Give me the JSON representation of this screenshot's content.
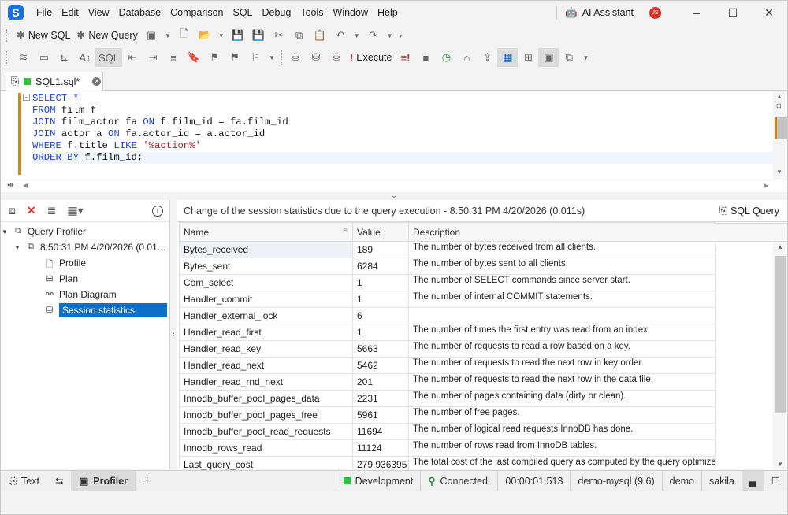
{
  "menu": [
    "File",
    "Edit",
    "View",
    "Database",
    "Comparison",
    "SQL",
    "Debug",
    "Tools",
    "Window",
    "Help"
  ],
  "ai_assistant": {
    "label": "AI Assistant",
    "avatar_initials": "JS"
  },
  "window_controls": {
    "minimize": "–",
    "maximize": "☐",
    "close": "✕"
  },
  "toolbar1": {
    "new_sql": "New SQL",
    "new_query": "New Query"
  },
  "toolbar2": {
    "execute": "Execute"
  },
  "doc_tab": {
    "label": "SQL1.sql*"
  },
  "editor": {
    "lines": [
      [
        {
          "t": "SELECT *",
          "c": "kw"
        }
      ],
      [
        {
          "t": "FROM ",
          "c": "kw"
        },
        {
          "t": "film f",
          "c": "id"
        }
      ],
      [
        {
          "t": "JOIN ",
          "c": "kw"
        },
        {
          "t": "film_actor fa ",
          "c": "id"
        },
        {
          "t": "ON ",
          "c": "kw"
        },
        {
          "t": "f.film_id = fa.film_id",
          "c": "id"
        }
      ],
      [
        {
          "t": "JOIN ",
          "c": "kw"
        },
        {
          "t": "actor a ",
          "c": "id"
        },
        {
          "t": "ON ",
          "c": "kw"
        },
        {
          "t": "fa.actor_id = a.actor_id",
          "c": "id"
        }
      ],
      [
        {
          "t": "WHERE ",
          "c": "kw"
        },
        {
          "t": "f.title ",
          "c": "id"
        },
        {
          "t": "LIKE ",
          "c": "kw"
        },
        {
          "t": "'%action%'",
          "c": "str"
        }
      ],
      [
        {
          "t": "ORDER BY ",
          "c": "kw"
        },
        {
          "t": "f.film_id;",
          "c": "id"
        }
      ]
    ]
  },
  "profiler_tree": {
    "root": "Query Profiler",
    "session": "8:50:31 PM 4/20/2026 (0.01...",
    "children": [
      "Profile",
      "Plan",
      "Plan Diagram",
      "Session statistics"
    ]
  },
  "stats_panel": {
    "header": "Change of the session statistics due to the query execution - 8:50:31 PM 4/20/2026 (0.011s)",
    "sql_query_button": "SQL Query",
    "columns": [
      "Name",
      "Value",
      "Description"
    ],
    "rows": [
      {
        "name": "Bytes_received",
        "value": "189",
        "desc": "The number of bytes received from all clients."
      },
      {
        "name": "Bytes_sent",
        "value": "6284",
        "desc": "The number of bytes sent to all clients."
      },
      {
        "name": "Com_select",
        "value": "1",
        "desc": "The number of SELECT commands since server start."
      },
      {
        "name": "Handler_commit",
        "value": "1",
        "desc": "The number of internal COMMIT statements."
      },
      {
        "name": "Handler_external_lock",
        "value": "6",
        "desc": ""
      },
      {
        "name": "Handler_read_first",
        "value": "1",
        "desc": "The number of times the first entry was read from an index."
      },
      {
        "name": "Handler_read_key",
        "value": "5663",
        "desc": "The number of requests to read a row based on a key."
      },
      {
        "name": "Handler_read_next",
        "value": "5462",
        "desc": "The number of requests to read the next row in key order."
      },
      {
        "name": "Handler_read_rnd_next",
        "value": "201",
        "desc": "The number of requests to read the next row in the data file."
      },
      {
        "name": "Innodb_buffer_pool_pages_data",
        "value": "2231",
        "desc": "The number of pages containing data (dirty or clean)."
      },
      {
        "name": "Innodb_buffer_pool_pages_free",
        "value": "5961",
        "desc": "The number of free pages."
      },
      {
        "name": "Innodb_buffer_pool_read_requests",
        "value": "11694",
        "desc": "The number of logical read requests InnoDB has done."
      },
      {
        "name": "Innodb_rows_read",
        "value": "11124",
        "desc": "The number of rows read from InnoDB tables."
      },
      {
        "name": "Last_query_cost",
        "value": "279.936395",
        "desc": "The total cost of the last compiled query as computed by the query optimizer."
      }
    ]
  },
  "status_bar": {
    "tabs": [
      "Text",
      "Profiler"
    ],
    "environment": "Development",
    "connection": "Connected.",
    "elapsed": "00:00:01.513",
    "server": "demo-mysql (9.6)",
    "user": "demo",
    "database": "sakila"
  }
}
